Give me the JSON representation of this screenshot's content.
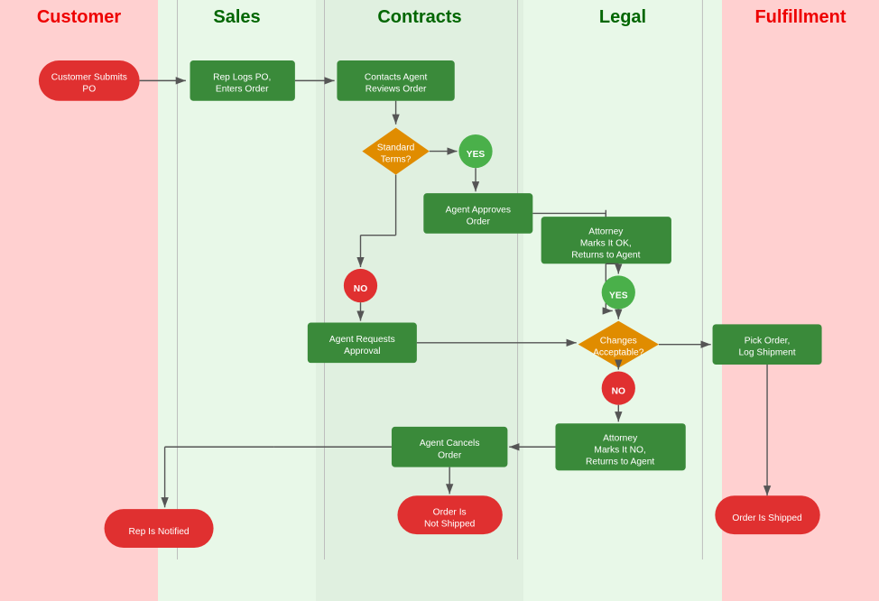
{
  "lanes": [
    {
      "id": "customer",
      "label": "Customer",
      "color": "#cc0000",
      "bg": "#ffd0d0"
    },
    {
      "id": "sales",
      "label": "Sales",
      "color": "#006600",
      "bg": "#e8f8e8"
    },
    {
      "id": "contracts",
      "label": "Contracts",
      "color": "#006600",
      "bg": "#e0f0e0"
    },
    {
      "id": "legal",
      "label": "Legal",
      "color": "#006600",
      "bg": "#e8f8e8"
    },
    {
      "id": "fulfillment",
      "label": "Fulfillment",
      "color": "#cc0000",
      "bg": "#ffd0d0"
    }
  ],
  "nodes": {
    "customer_submits": "Customer Submits\nPO",
    "rep_logs": "Rep Logs PO,\nEnters Order",
    "contacts_agent": "Contacts Agent\nReviews Order",
    "standard_terms": "Standard\nTerms?",
    "yes_1": "YES",
    "agent_approves": "Agent Approves\nOrder",
    "attorney_marks_ok": "Attorney\nMarks It OK,\nReturns to Agent",
    "yes_2": "YES",
    "changes_acceptable": "Changes\nAcceptable?",
    "no_1": "NO",
    "no_2": "NO",
    "agent_requests": "Agent Requests\nApproval",
    "pick_order": "Pick Order,\nLog Shipment",
    "attorney_marks_no": "Attorney\nMarks It NO,\nReturns to Agent",
    "agent_cancels": "Agent Cancels\nOrder",
    "rep_notified": "Rep Is Notified",
    "order_not_shipped": "Order Is\nNot Shipped",
    "order_shipped": "Order Is Shipped"
  }
}
